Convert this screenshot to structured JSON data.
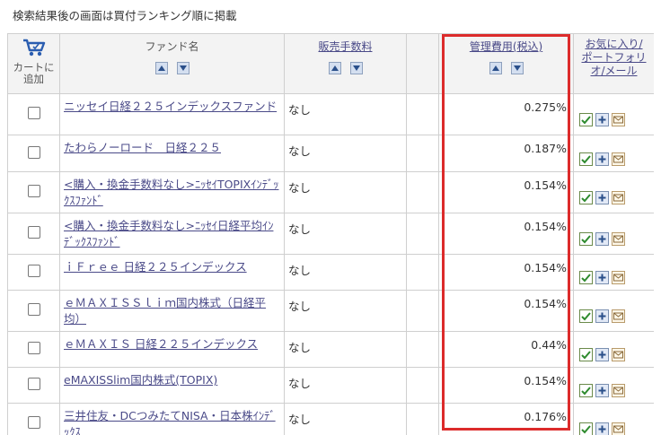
{
  "caption": "検索結果後の画面は買付ランキング順に掲載",
  "header": {
    "cart": "カートに追加",
    "fund_name": "ファンド名",
    "fee": "販売手数料",
    "cost": "管理費用(税込)",
    "fav_line1": "お気に入り/",
    "fav_line2": "ポートフォリ",
    "fav_line3": "オ/メール"
  },
  "icons": {
    "cart": "cart-icon",
    "sort_up": "sort-up-icon",
    "sort_down": "sort-down-icon",
    "check": "check-icon",
    "plus": "plus-icon",
    "mail": "mail-icon"
  },
  "colors": {
    "highlight": "#dc2b2b",
    "link": "#4a4a88",
    "header_bg": "#f3f3f3"
  },
  "rows": [
    {
      "name": "ニッセイ日経２２５インデックスファンド",
      "fee": "なし",
      "cost": "0.275%"
    },
    {
      "name": "たわらノーロード　日経２２５",
      "fee": "なし",
      "cost": "0.187%"
    },
    {
      "name": "<購入・換金手数料なし>ﾆｯｾｲTOPIXｲﾝﾃﾞｯｸｽﾌｧﾝﾄﾞ",
      "fee": "なし",
      "cost": "0.154%"
    },
    {
      "name": "<購入・換金手数料なし>ﾆｯｾｲ日経平均ｲﾝﾃﾞｯｸｽﾌｧﾝﾄﾞ",
      "fee": "なし",
      "cost": "0.154%"
    },
    {
      "name": "ｉＦｒｅｅ 日経２２５インデックス",
      "fee": "なし",
      "cost": "0.154%"
    },
    {
      "name": "ｅＭＡＸＩＳＳｌｉｍ国内株式（日経平均）",
      "fee": "なし",
      "cost": "0.154%"
    },
    {
      "name": "ｅＭＡＸＩＳ 日経２２５インデックス",
      "fee": "なし",
      "cost": "0.44%"
    },
    {
      "name": "eMAXISSlim国内株式(TOPIX)",
      "fee": "なし",
      "cost": "0.154%"
    },
    {
      "name": "三井住友・DCつみたてNISA・日本株ｲﾝﾃﾞｯｸｽ",
      "fee": "なし",
      "cost": "0.176%"
    }
  ]
}
